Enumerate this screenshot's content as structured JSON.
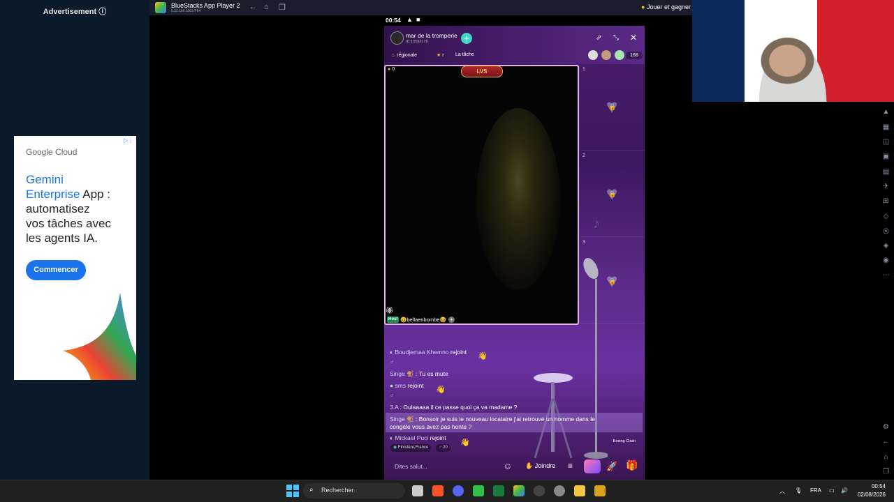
{
  "ad_sidebar": {
    "label": "Advertisement ⓘ",
    "card": {
      "brand": "Google Cloud",
      "headline_line1": "Gemini",
      "headline_line2_blue": "Enterprise",
      "headline_line2_rest": " App :",
      "headline_line3": "automatisez",
      "headline_line4": "vos tâches avec",
      "headline_line5": "les agents IA.",
      "cta": "Commencer"
    }
  },
  "bluestacks": {
    "title": "BlueStacks App Player 2",
    "subtitle": "5.22.166.1003 P64",
    "promo": "Jouer et gagner"
  },
  "phone": {
    "status_time": "00:54",
    "room": {
      "name": "mar de la tromperie",
      "id": "ID:10592178",
      "tag_region": "régionale",
      "tag_star": "r",
      "tag_task": "La tâche",
      "viewer_count": "168",
      "coin_count": "0"
    },
    "host": {
      "badge": "Host",
      "name": "😆bellaenbombe😆"
    },
    "seats": [
      {
        "num": "1"
      },
      {
        "num": "2"
      },
      {
        "num": "3"
      }
    ],
    "chat": [
      {
        "name": "Boudjemaa Khemno",
        "text": " rejoint"
      },
      {
        "name": "Singe 🐒",
        "text": " : Tu es mute"
      },
      {
        "name": "sms",
        "text": " rejoint"
      },
      {
        "name": "3.A",
        "text": " : Oulaaaaa il ce passe quoi ça va madame ?"
      },
      {
        "name": "Singe 🐒",
        "text": " : Bonsoir je suis le nouveau locataire j'ai retrouvé un homme dans le"
      },
      {
        "name": "",
        "text": "congèle vous avez pas honte ?"
      },
      {
        "name": "Mickael Puci",
        "text": " rejoint"
      }
    ],
    "location": "Finistère,France",
    "age": "20",
    "input_placeholder": "Dites salut...",
    "join_label": "Joindre",
    "game_label": "Boxing Clash"
  },
  "taskbar": {
    "search_label": "Rechercher",
    "lang": "FRA",
    "time": "00:54",
    "date": "02/08/2026"
  }
}
